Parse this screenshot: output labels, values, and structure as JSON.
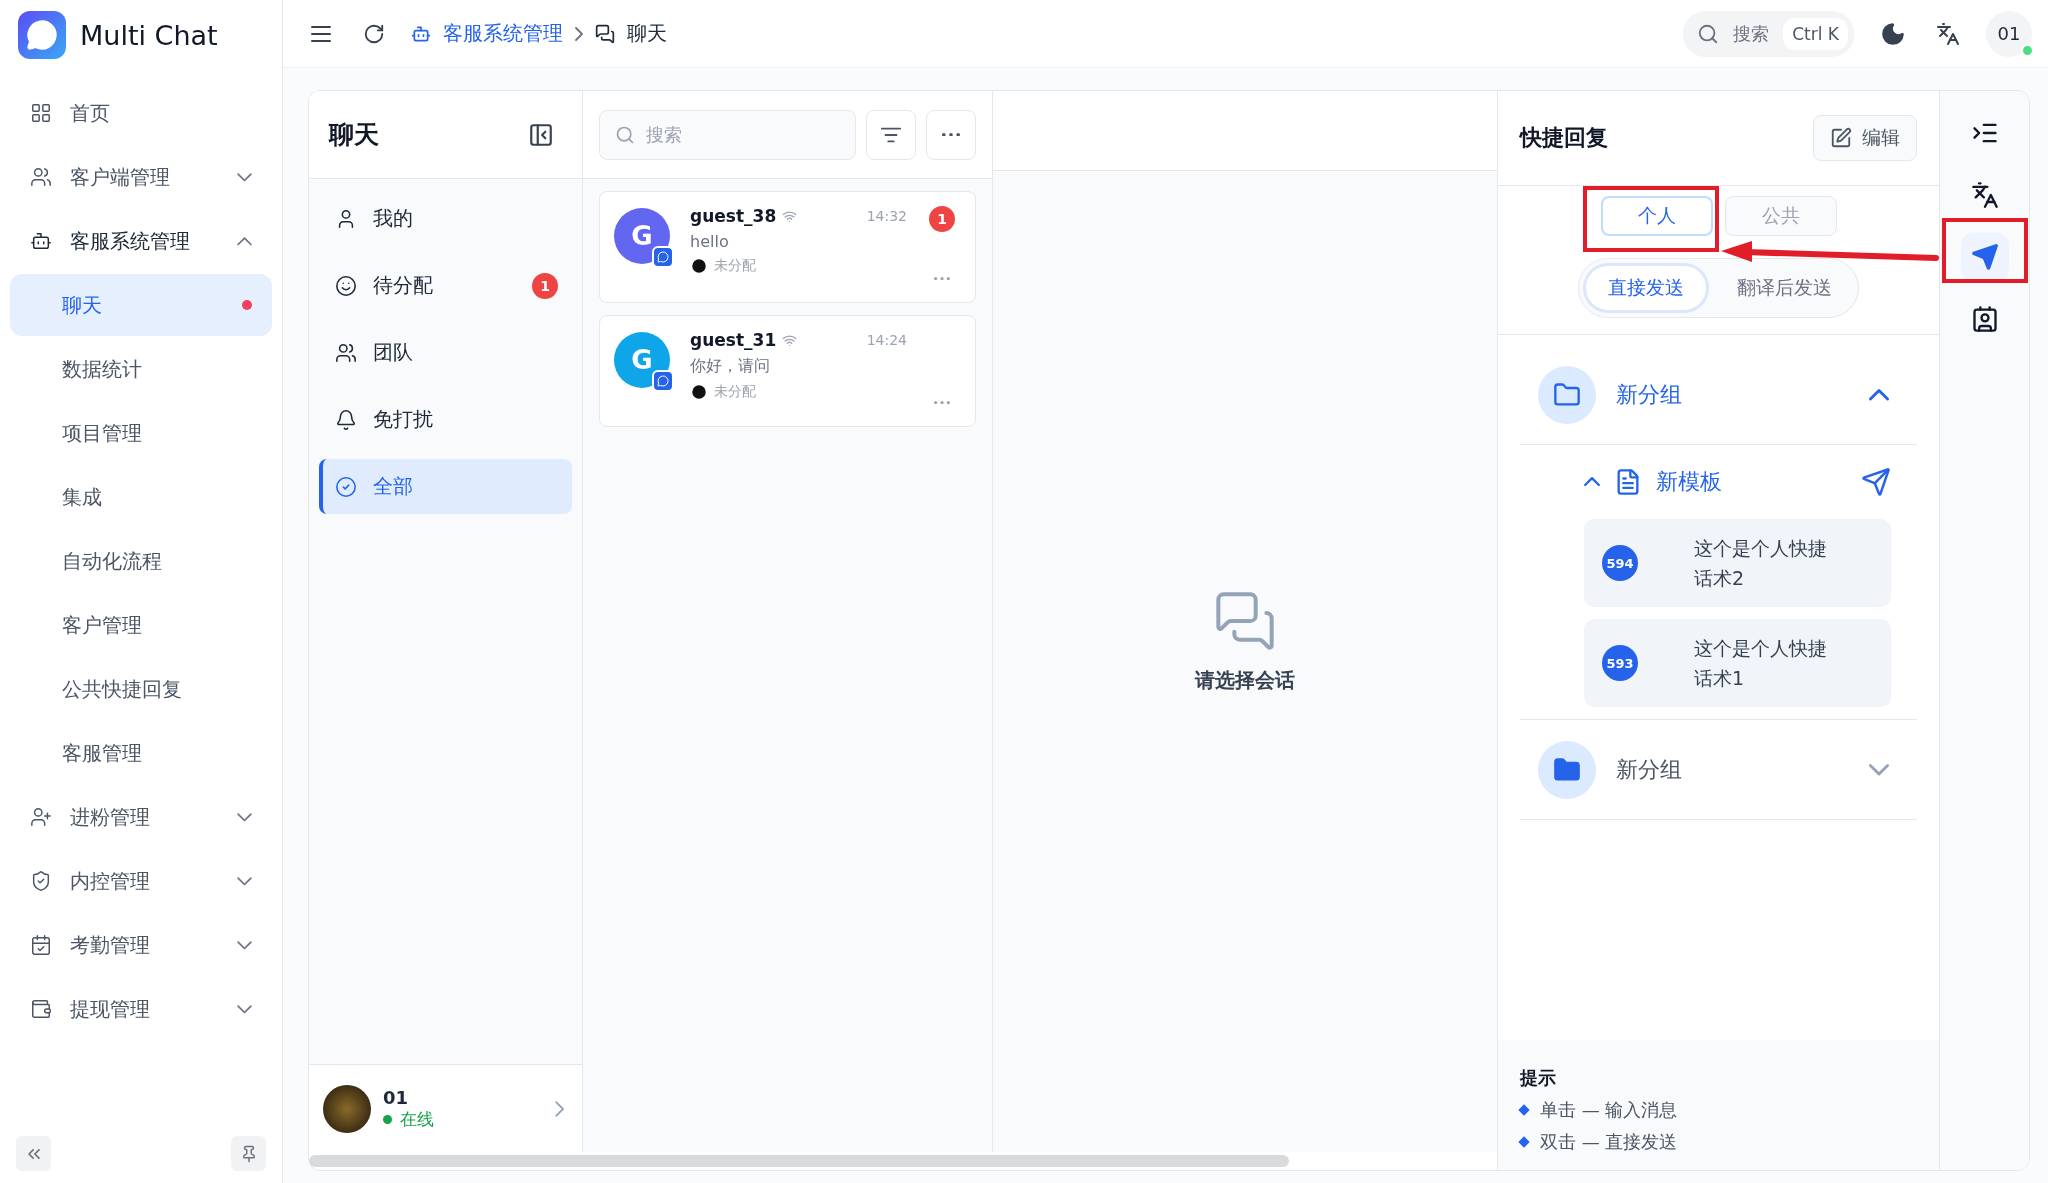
{
  "sidebar": {
    "brand": "Multi Chat",
    "items": [
      {
        "label": "首页",
        "expandable": false,
        "selected": false
      },
      {
        "label": "客户端管理",
        "expandable": true,
        "expanded": false,
        "selected": false
      },
      {
        "label": "客服系统管理",
        "expandable": true,
        "expanded": true,
        "selected": false,
        "children": [
          {
            "label": "聊天",
            "selected": true,
            "unread": true
          },
          {
            "label": "数据统计",
            "selected": false,
            "unread": false
          },
          {
            "label": "项目管理",
            "selected": false,
            "unread": false
          },
          {
            "label": "集成",
            "selected": false,
            "unread": false
          },
          {
            "label": "自动化流程",
            "selected": false,
            "unread": false
          },
          {
            "label": "客户管理",
            "selected": false,
            "unread": false
          },
          {
            "label": "公共快捷回复",
            "selected": false,
            "unread": false
          },
          {
            "label": "客服管理",
            "selected": false,
            "unread": false
          }
        ]
      },
      {
        "label": "进粉管理",
        "expandable": true,
        "expanded": false,
        "selected": false
      },
      {
        "label": "内控管理",
        "expandable": true,
        "expanded": false,
        "selected": false
      },
      {
        "label": "考勤管理",
        "expandable": true,
        "expanded": false,
        "selected": false
      },
      {
        "label": "提现管理",
        "expandable": true,
        "expanded": false,
        "selected": false
      }
    ]
  },
  "header": {
    "breadcrumb": [
      {
        "label": "客服系统管理",
        "kind": "link"
      },
      {
        "label": "聊天",
        "kind": "current"
      }
    ],
    "search": {
      "placeholder": "搜索",
      "shortcut": "Ctrl K"
    },
    "user": {
      "label": "01",
      "online": true
    }
  },
  "chat_nav": {
    "title": "聊天",
    "items": [
      {
        "label": "我的",
        "selected": false
      },
      {
        "label": "待分配",
        "selected": false,
        "badge": "1"
      },
      {
        "label": "团队",
        "selected": false
      },
      {
        "label": "免打扰",
        "selected": false
      },
      {
        "label": "全部",
        "selected": true
      }
    ],
    "user": {
      "name": "01",
      "status": "在线",
      "online": true
    }
  },
  "conversations": {
    "search": {
      "placeholder": "搜索"
    },
    "items": [
      {
        "name": "guest_38",
        "initial": "G",
        "color": "#6366f1",
        "time": "14:32",
        "message": "hello",
        "assignee": "未分配",
        "unread": "1"
      },
      {
        "name": "guest_31",
        "initial": "G",
        "color": "#0ea5e9",
        "time": "14:24",
        "message": "你好，请问",
        "assignee": "未分配"
      }
    ]
  },
  "empty_state": {
    "text": "请选择会话"
  },
  "quick_reply": {
    "title": "快捷回复",
    "edit": "编辑",
    "scopes": [
      {
        "label": "个人",
        "selected": true
      },
      {
        "label": "公共",
        "selected": false
      }
    ],
    "send_modes": [
      {
        "label": "直接发送",
        "selected": true
      },
      {
        "label": "翻译后发送",
        "selected": false
      }
    ],
    "groups": [
      {
        "name": "新分组",
        "expanded": true,
        "templates": [
          {
            "name": "新模板",
            "expanded": true,
            "replies": [
              {
                "id": "594",
                "text": "这个是个人快捷话术2"
              },
              {
                "id": "593",
                "text": "这个是个人快捷话术1"
              }
            ]
          }
        ]
      },
      {
        "name": "新分组",
        "expanded": false
      }
    ],
    "tips": {
      "title": "提示",
      "items": [
        "单击 — 输入消息",
        "双击 — 直接发送"
      ]
    }
  },
  "right_rail": [
    {
      "selected": false
    },
    {
      "selected": false
    },
    {
      "selected": true
    },
    {
      "selected": false
    }
  ],
  "annotations": [
    {
      "kind": "box"
    },
    {
      "kind": "box"
    },
    {
      "kind": "arrow"
    }
  ]
}
